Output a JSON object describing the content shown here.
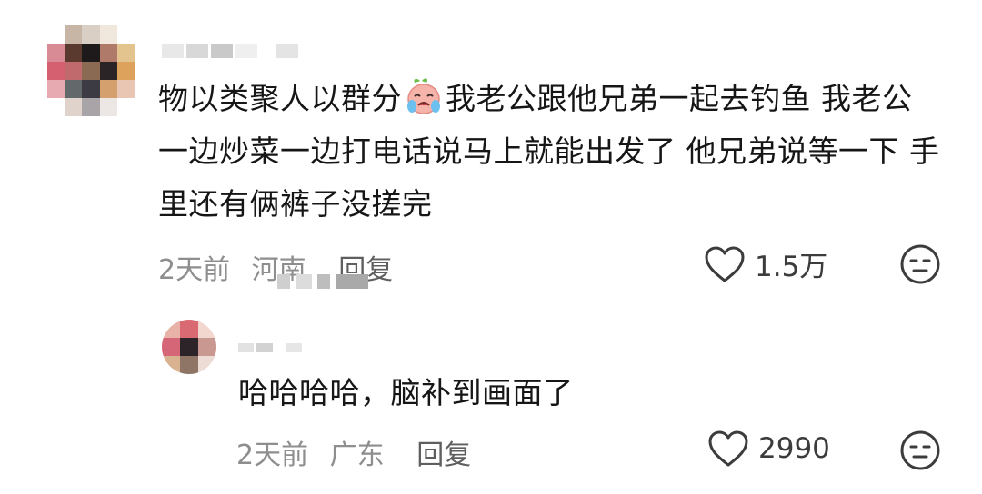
{
  "comments": [
    {
      "text_before_emoji": "物以类聚人以群分",
      "emoji": "crying-face-icon",
      "text_after_emoji": "我老公跟他兄弟一起去钓鱼 我老公一边炒菜一边打电话说马上就能出发了 他兄弟说等一下 手里还有俩裤子没搓完",
      "time": "2天前",
      "location": "河南",
      "reply_label": "回复",
      "like_count": "1.5万"
    },
    {
      "text": "哈哈哈哈，脑补到画面了",
      "time": "2天前",
      "location": "广东",
      "reply_label": "回复",
      "like_count": "2990"
    }
  ],
  "colors": {
    "text": "#161616",
    "meta": "#8e8e8e",
    "icon": "#3c3c3c"
  }
}
